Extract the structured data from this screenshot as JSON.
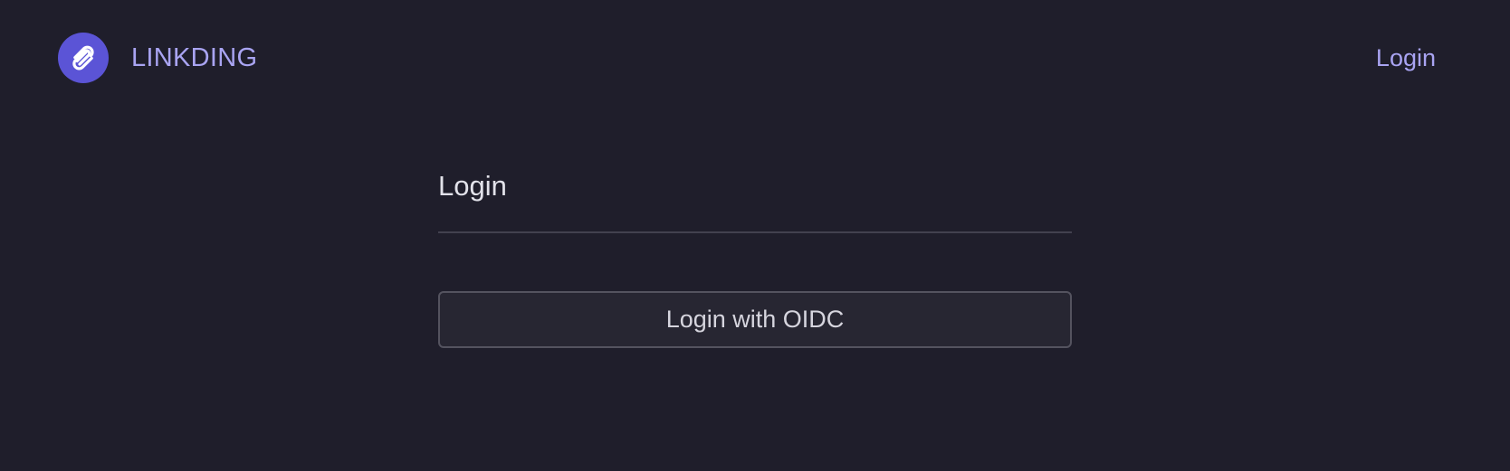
{
  "header": {
    "brand_name": "LINKDING",
    "logo_icon": "paperclip-link-icon",
    "nav_login_label": "Login"
  },
  "main": {
    "title": "Login",
    "oidc_button_label": "Login with OIDC"
  },
  "colors": {
    "background": "#1f1e2b",
    "accent": "#5b54d6",
    "link": "#a9a4f2",
    "button_bg": "#272632",
    "button_border": "#54535f",
    "divider": "#42414f",
    "text": "#e2e2ea"
  }
}
